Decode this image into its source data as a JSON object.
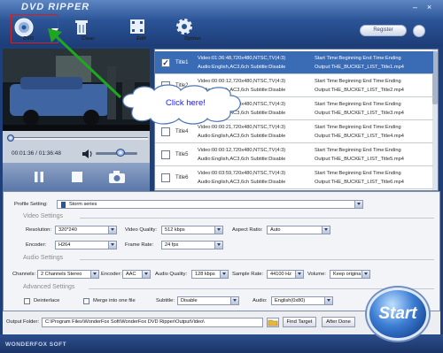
{
  "app": {
    "title": "DVD RIPPER",
    "brand": "WONDERFOX SOFT"
  },
  "toolbar": {
    "dvd_label": "DVD",
    "clear_label": "Clear",
    "edit_label": "Edit",
    "option_label": "Option",
    "register_label": "Register"
  },
  "player": {
    "time": "00:01:36 / 01:36:48",
    "progress_fraction": 0.017,
    "volume_fraction": 0.55
  },
  "titles": [
    {
      "name": "Title1",
      "checked": true,
      "selected": true,
      "info1": "Video:01:36:48,720x480,NTSC,TV(4:3)",
      "info2": "Audio:English,AC3,6ch Subtitle:Disable",
      "st1": "Start Time:Beginning End Time:Ending",
      "st2": "Output:THE_BUCKET_LIST_Title1.mp4"
    },
    {
      "name": "Title2",
      "checked": false,
      "selected": false,
      "info1": "Video:00:00:12,720x480,NTSC,TV(4:3)",
      "info2": "Audio:English,AC3,6ch Subtitle:Disable",
      "st1": "Start Time:Beginning End Time:Ending",
      "st2": "Output:THE_BUCKET_LIST_Title2.mp4"
    },
    {
      "name": "Title3",
      "checked": false,
      "selected": false,
      "info1": "Video:00:00:12,720x480,NTSC,TV(4:3)",
      "info2": "Audio:English,AC3,6ch Subtitle:Disable",
      "st1": "Start Time:Beginning End Time:Ending",
      "st2": "Output:THE_BUCKET_LIST_Title3.mp4"
    },
    {
      "name": "Title4",
      "checked": false,
      "selected": false,
      "info1": "Video:00:00:21,720x480,NTSC,TV(4:3)",
      "info2": "Audio:English,AC3,6ch Subtitle:Disable",
      "st1": "Start Time:Beginning End Time:Ending",
      "st2": "Output:THE_BUCKET_LIST_Title4.mp4"
    },
    {
      "name": "Title5",
      "checked": false,
      "selected": false,
      "info1": "Video:00:00:12,720x480,NTSC,TV(4:3)",
      "info2": "Audio:English,AC3,6ch Subtitle:Disable",
      "st1": "Start Time:Beginning End Time:Ending",
      "st2": "Output:THE_BUCKET_LIST_Title5.mp4"
    },
    {
      "name": "Title6",
      "checked": false,
      "selected": false,
      "info1": "Video:00:03:59,720x480,NTSC,TV(4:3)",
      "info2": "Audio:English,AC3,6ch Subtitle:Disable",
      "st1": "Start Time:Beginning End Time:Ending",
      "st2": "Output:THE_BUCKET_LIST_Title6.mp4"
    }
  ],
  "callout": "Click here!",
  "settings": {
    "profile_label": "Profile Setting:",
    "profile_value": "Storm series",
    "video_title": "Video Settings",
    "resolution_label": "Resolution:",
    "resolution_value": "320*240",
    "video_quality_label": "Video Quality:",
    "video_quality_value": "512 kbps",
    "aspect_label": "Aspect Ratio:",
    "aspect_value": "Auto",
    "encoder_label": "Encoder:",
    "encoder_value": "H264",
    "frame_rate_label": "Frame Rate:",
    "frame_rate_value": "24 fps",
    "audio_title": "Audio Settings",
    "channels_label": "Channels:",
    "channels_value": "2 Channels Stereo",
    "audio_encoder_label": "Encoder:",
    "audio_encoder_value": "AAC",
    "audio_quality_label": "Audio Quality:",
    "audio_quality_value": "128 kbps",
    "sample_rate_label": "Sample Rate:",
    "sample_rate_value": "44100 Hz",
    "volume_label": "Volume:",
    "volume_value": "Keep origina",
    "advanced_title": "Advanced Settings",
    "deinterlace_label": "Deinterlace",
    "merge_label": "Merge into one file",
    "subtitle_label": "Subtitle:",
    "subtitle_value": "Disable",
    "audio_label": "Audio:",
    "audio_value": "English(0x80)"
  },
  "output": {
    "label": "Output Folder:",
    "path": "C:\\Program Files\\WonderFox Soft\\WonderFox DVD Ripper\\OutputVideo\\",
    "find_target": "Find Target",
    "after_done": "After Done",
    "start": "Start"
  },
  "colors": {
    "chrome": "#1e3f78",
    "selected_row": "#3a6bb5",
    "arrow": "#1fa81f",
    "highlight_box": "#d42020"
  }
}
